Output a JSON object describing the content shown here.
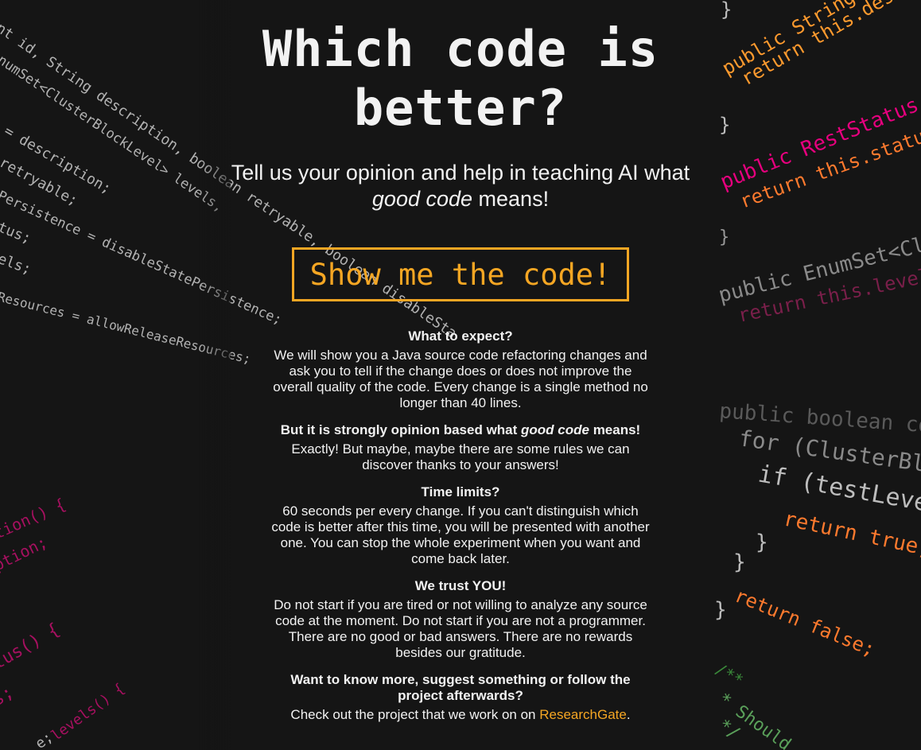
{
  "page": {
    "title": "Which code is better?",
    "tagline_part1": "Tell us your opinion and help in teaching AI what ",
    "tagline_em": "good code",
    "tagline_part2": " means!",
    "cta_label": "Show me the code!"
  },
  "faq": [
    {
      "question": "What to expect?",
      "answer": "We will show you a Java source code refactoring changes and ask you to tell if the change does or does not improve the overall quality of the code. Every change is a single method no longer than 40 lines."
    },
    {
      "question_part1": "But it is strongly opinion based what ",
      "question_em": "good code",
      "question_part2": " means!",
      "answer": "Exactly! But maybe, maybe there are some rules we can discover thanks to your answers!"
    },
    {
      "question": "Time limits?",
      "answer": "60 seconds per every change. If you can't distinguish which code is better after this time, you will be presented with another one. You can stop the whole experiment when you want and come back later."
    },
    {
      "question": "We trust YOU!",
      "answer": "Do not start if you are tired or not willing to analyze any source code at the moment. Do not start if you are not a programmer. There are no good or bad answers. There are no rewards besides our gratitude."
    },
    {
      "question": "Want to know more, suggest something or follow the project afterwards?",
      "answer_part1": "Check out the project that we work on on ",
      "answer_link": "ResearchGate",
      "answer_part2": "."
    }
  ],
  "background": {
    "left_lines": [
      "nt id, String description, boolean retryable, boolean disableSta",
      "numSet<ClusterBlockLevel> levels,",
      "= description;",
      "retryable;",
      "Persistence = disableStatePersistence;",
      "tus;",
      "els;",
      "Resources = allowReleaseResources;",
      "tion() {",
      "ption;",
      "tus() {",
      "s;",
      "levels() {",
      "e;"
    ],
    "right_lines": [
      "}",
      "public String desc",
      "return this.descr",
      "}",
      "public RestStatus status() {",
      "return this.status;",
      "}",
      "public EnumSet<ClusterBlockL",
      "return this.levels;",
      "public boolean contains(Clus",
      "for (ClusterBlockLevel te",
      "if (testLevel == leve",
      "return true;",
      "}",
      "}",
      "return false;",
      "}",
      "/**",
      "* Should on",
      "*/"
    ],
    "colors": {
      "text": "#e0e0e0",
      "keyword": "#ff9a2e",
      "member": "#e6007e"
    }
  },
  "colors": {
    "accent": "#f5a623",
    "background": "#151515",
    "text": "#f2f2f2"
  }
}
